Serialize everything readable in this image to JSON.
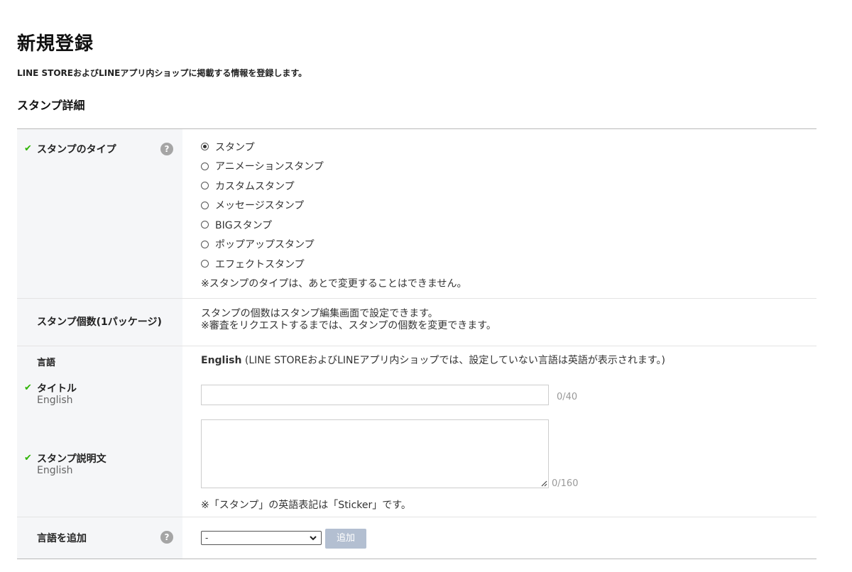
{
  "header": {
    "title": "新規登録",
    "subtitle": "LINE STOREおよびLINEアプリ内ショップに掲載する情報を登録します。",
    "section_title": "スタンプ詳細"
  },
  "rows": {
    "sticker_type": {
      "label": "スタンプのタイプ",
      "help_icon": "?",
      "options": [
        "スタンプ",
        "アニメーションスタンプ",
        "カスタムスタンプ",
        "メッセージスタンプ",
        "BIGスタンプ",
        "ポップアップスタンプ",
        "エフェクトスタンプ"
      ],
      "selected_index": 0,
      "note": "※スタンプのタイプは、あとで変更することはできません。"
    },
    "count": {
      "label": "スタンプ個数(1パッケージ)",
      "line1": "スタンプの個数はスタンプ編集画面で設定できます。",
      "line2": "※審査をリクエストするまでは、スタンプの個数を変更できます。"
    },
    "language": {
      "label": "言語",
      "value_bold": "English",
      "value_note": "(LINE STOREおよびLINEアプリ内ショップでは、設定していない言語は英語が表示されます。)",
      "title_label": "タイトル",
      "title_sub": "English",
      "title_value": "",
      "title_counter": "0/40",
      "desc_label": "スタンプ説明文",
      "desc_sub": "English",
      "desc_value": "",
      "desc_counter": "0/160",
      "desc_note": "※「スタンプ」の英語表記は「Sticker」です。"
    },
    "add_language": {
      "label": "言語を追加",
      "help_icon": "?",
      "select_value": "-",
      "button_label": "追加"
    }
  },
  "icons": {
    "check": "check-icon",
    "help": "help-icon"
  },
  "colors": {
    "check_green": "#2db400",
    "label_bg": "#f5f6f8",
    "button_disabled": "#b3bfd1"
  }
}
